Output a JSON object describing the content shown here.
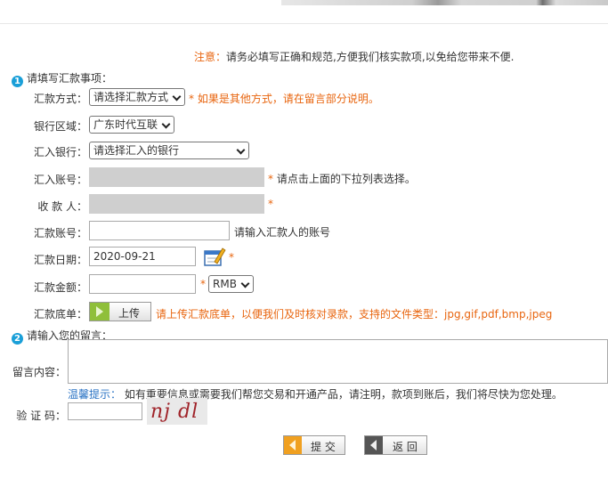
{
  "notice": {
    "label": "注意：",
    "text": "请务必填写正确和规范,方便我们核实款项,以免给您带来不便."
  },
  "sections": {
    "s1_num": "1",
    "s1_title": "请填写汇款事项：",
    "s2_num": "2",
    "s2_title": "请输入您的留言："
  },
  "form": {
    "method": {
      "label": "汇款方式：",
      "value": "请选择汇款方式",
      "hint": "* 如果是其他方式，请在留言部分说明。"
    },
    "region": {
      "label": "银行区域：",
      "value": "广东时代互联"
    },
    "bank": {
      "label": "汇入银行：",
      "value": "请选择汇入的银行"
    },
    "account_in": {
      "label": "汇入账号：",
      "hint": "请点击上面的下拉列表选择。"
    },
    "payee": {
      "label": "收 款 人："
    },
    "account_out": {
      "label": "汇款账号：",
      "hint": "请输入汇款人的账号"
    },
    "date": {
      "label": "汇款日期：",
      "value": "2020-09-21"
    },
    "amount": {
      "label": "汇款金额：",
      "currency": "RMB"
    },
    "receipt": {
      "label": "汇款底单：",
      "button": "上传",
      "hint": "请上传汇款底单，以便我们及时核对录款，支持的文件类型：jpg,gif,pdf,bmp,jpeg"
    },
    "message": {
      "label": "留言内容："
    },
    "tip": {
      "label": "温馨提示：",
      "text": "如有重要信息或需要我们帮您交易和开通产品，请注明，款项到账后，我们将尽快为您处理。"
    },
    "captcha": {
      "label": "验 证 码：",
      "image_text": "nj dl"
    },
    "star": "*"
  },
  "buttons": {
    "submit": "提 交",
    "back": "返 回"
  },
  "colors": {
    "accent_orange": "#e8650f",
    "section_blue": "#1a9fd8",
    "tip_blue": "#2a73c4"
  }
}
